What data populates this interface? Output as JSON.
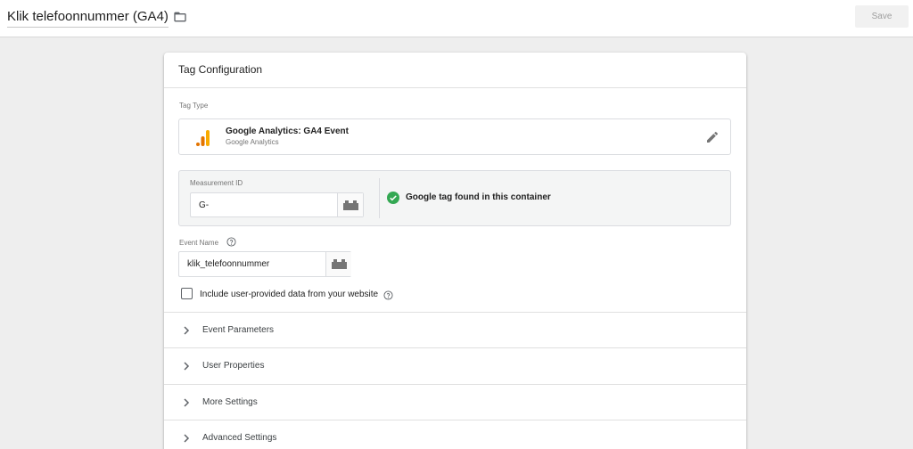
{
  "header": {
    "title": "Klik telefoonnummer (GA4)",
    "save_label": "Save"
  },
  "card": {
    "title": "Tag Configuration",
    "tag_type": {
      "label": "Tag Type",
      "name": "Google Analytics: GA4 Event",
      "vendor": "Google Analytics"
    },
    "measurement": {
      "label": "Measurement ID",
      "value": "G-",
      "status": "Google tag found in this container"
    },
    "event_name": {
      "label": "Event Name",
      "value": "klik_telefoonnummer"
    },
    "user_data_checkbox": {
      "label": "Include user-provided data from your website",
      "checked": false
    },
    "sections": [
      {
        "label": "Event Parameters"
      },
      {
        "label": "User Properties"
      },
      {
        "label": "More Settings"
      },
      {
        "label": "Advanced Settings"
      }
    ]
  },
  "colors": {
    "success_green": "#34a853",
    "ga_orange": "#f9ab00",
    "ga_orange_dark": "#e37400"
  }
}
